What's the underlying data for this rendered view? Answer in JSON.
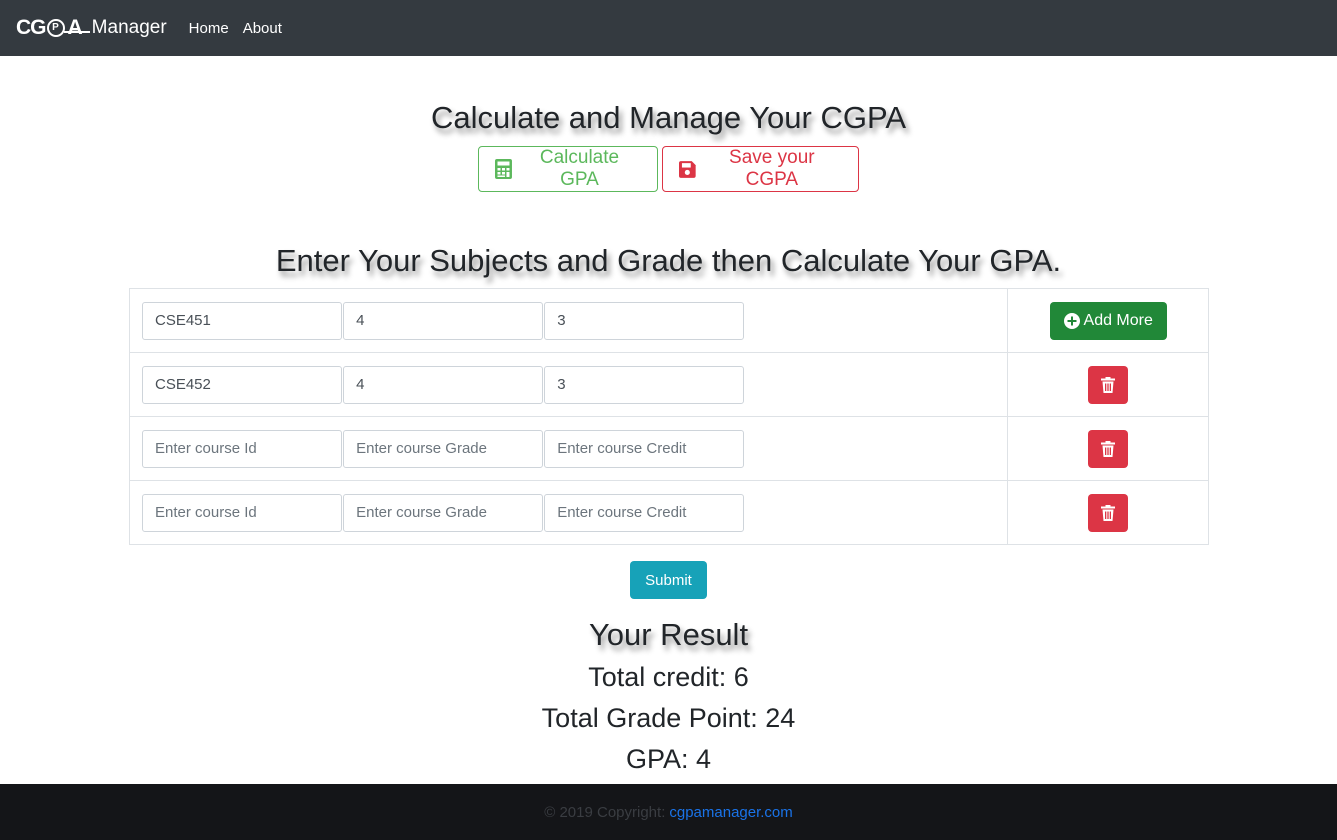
{
  "navbar": {
    "logo_text_left": "CG",
    "logo_text_p": "P",
    "logo_text_right": "A",
    "brand_name": "Manager",
    "links": [
      "Home",
      "About"
    ]
  },
  "hero": {
    "title": "Calculate and Manage Your CGPA",
    "calc_button": "Calculate GPA",
    "save_button": "Save your CGPA",
    "calc_icon": "calculator-icon",
    "save_icon": "floppy-disk-icon"
  },
  "form": {
    "title": "Enter Your Subjects and Grade then Calculate Your GPA.",
    "placeholders": {
      "course_id": "Enter course Id",
      "grade": "Enter course Grade",
      "credit": "Enter course Credit"
    },
    "rows": [
      {
        "course_id": "CSE451",
        "grade": "4",
        "credit": "3"
      },
      {
        "course_id": "CSE452",
        "grade": "4",
        "credit": "3"
      },
      {
        "course_id": "",
        "grade": "",
        "credit": ""
      },
      {
        "course_id": "",
        "grade": "",
        "credit": ""
      }
    ],
    "add_more_label": "Add More",
    "add_icon": "plus-circle-icon",
    "delete_icon": "trash-icon",
    "submit_label": "Submit"
  },
  "result": {
    "title": "Your Result",
    "total_credit": "Total credit: 6",
    "total_grade_point": "Total Grade Point: 24",
    "gpa": "GPA: 4"
  },
  "footer": {
    "copyright": "© 2019 Copyright:",
    "link": "cgpamanager.com"
  },
  "colors": {
    "navbar": "#343a40",
    "success": "#5cb85c",
    "danger": "#dc3545",
    "add_button": "#218838",
    "submit": "#17a2b8",
    "footer": "#141518",
    "footer_link": "#1a73e8"
  }
}
